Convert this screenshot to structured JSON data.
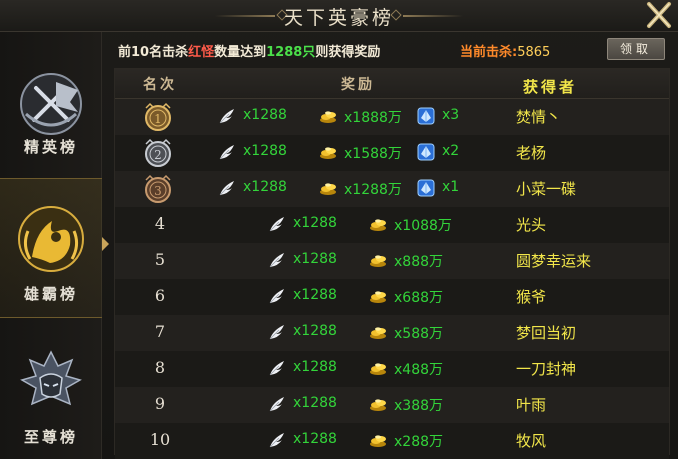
{
  "window": {
    "title": "天下英豪榜"
  },
  "sidebar": {
    "items": [
      {
        "label": "精英榜",
        "icon": "elite-flag-emblem-icon",
        "selected": false
      },
      {
        "label": "雄霸榜",
        "icon": "warrior-emblem-icon",
        "selected": true
      },
      {
        "label": "至尊榜",
        "icon": "supreme-helmet-emblem-icon",
        "selected": false
      }
    ]
  },
  "info": {
    "text_a": "前10名击杀",
    "text_red": "红怪",
    "text_b": "数量达到",
    "text_green": "1288只",
    "text_c": "则获得奖励",
    "kills_label": "当前击杀:",
    "kills_value": "5865",
    "claim_label": "领取"
  },
  "table": {
    "headers": {
      "rank": "名次",
      "reward": "奖励",
      "winner": "获得者"
    },
    "rows": [
      {
        "rank": "1",
        "medal": "gold",
        "feather": "x1288",
        "gold": "x1888万",
        "crystal": "x3",
        "winner": "焚情丶"
      },
      {
        "rank": "2",
        "medal": "silver",
        "feather": "x1288",
        "gold": "x1588万",
        "crystal": "x2",
        "winner": "老杨"
      },
      {
        "rank": "3",
        "medal": "bronze",
        "feather": "x1288",
        "gold": "x1288万",
        "crystal": "x1",
        "winner": "小菜一碟"
      },
      {
        "rank": "4",
        "feather": "x1288",
        "gold": "x1088万",
        "winner": "光头"
      },
      {
        "rank": "5",
        "feather": "x1288",
        "gold": "x888万",
        "winner": "圆梦幸运来"
      },
      {
        "rank": "6",
        "feather": "x1288",
        "gold": "x688万",
        "winner": "猴爷"
      },
      {
        "rank": "7",
        "feather": "x1288",
        "gold": "x588万",
        "winner": "梦回当初"
      },
      {
        "rank": "8",
        "feather": "x1288",
        "gold": "x488万",
        "winner": "一刀封神"
      },
      {
        "rank": "9",
        "feather": "x1288",
        "gold": "x388万",
        "winner": "叶雨"
      },
      {
        "rank": "10",
        "feather": "x1288",
        "gold": "x288万",
        "winner": "牧风"
      }
    ]
  },
  "colors": {
    "reward_green": "#33d43a",
    "winner_yellow": "#f2e64a",
    "kills_orange": "#ff8a2a",
    "accent_gold": "#c9a45a"
  }
}
